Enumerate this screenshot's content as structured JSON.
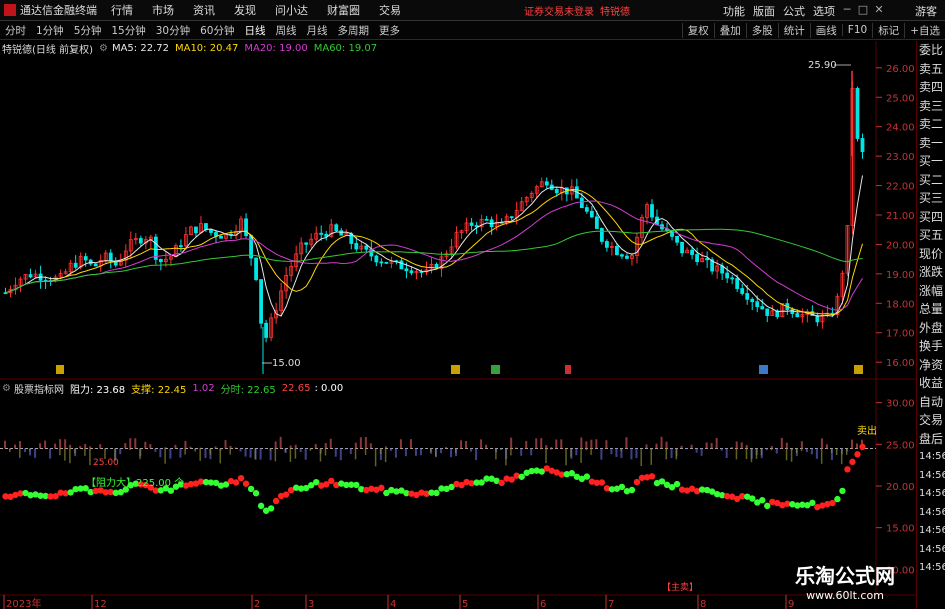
{
  "app": {
    "title": "通达信金融终端",
    "guest_label": "游客"
  },
  "menu": {
    "items": [
      "行情",
      "市场",
      "资讯",
      "发现",
      "问小达",
      "财富圈",
      "交易"
    ],
    "trade_notice": "证券交易未登录",
    "stock_notice": "特锐德"
  },
  "right_menu": [
    "功能",
    "版面",
    "公式",
    "选项"
  ],
  "toolbar": {
    "periods": [
      "分时",
      "1分钟",
      "5分钟",
      "15分钟",
      "30分钟",
      "60分钟",
      "日线",
      "周线",
      "月线",
      "多周期",
      "更多"
    ],
    "active": "日线",
    "right": [
      "复权",
      "叠加",
      "多股",
      "统计",
      "画线",
      "F10",
      "标记",
      "+自选"
    ]
  },
  "price_chart": {
    "stock_label": "特锐德(日线 前复权)",
    "ma": [
      {
        "label": "MA5: 22.72",
        "color": "#e8e8e8"
      },
      {
        "label": "MA10: 20.47",
        "color": "#ffd700"
      },
      {
        "label": "MA20: 19.00",
        "color": "#d23cd2"
      },
      {
        "label": "MA60: 19.07",
        "color": "#34c834"
      }
    ],
    "y_ticks": [
      "26.00",
      "25.00",
      "24.00",
      "23.00",
      "22.00",
      "21.00",
      "20.00",
      "19.00",
      "18.00",
      "17.00",
      "16.00"
    ],
    "y_range": [
      15.7,
      26.3
    ],
    "high_label": "25.90",
    "high_value": 25.9,
    "low_label": "15.00",
    "low_value": 15.0
  },
  "indicator": {
    "name": "股票指标网",
    "items": [
      {
        "label": "阻力: 23.68",
        "color": "#ffffff"
      },
      {
        "label": "支撑: 22.45",
        "color": "#ffd700"
      },
      {
        "label": "1.02",
        "color": "#d23cd2"
      },
      {
        "label": "分时: 22.65",
        "color": "#34c834"
      },
      {
        "label": "22.65",
        "color": "#ff4040"
      },
      {
        "label": ": 0.00",
        "color": "#ffffff"
      }
    ],
    "y_ticks": [
      "30.00",
      "25.00",
      "20.00",
      "15.00",
      "10.00"
    ],
    "y_range": [
      8,
      32
    ],
    "annotation_a": "【阻力大】225.00 个",
    "annotation_b": "【主卖】",
    "annotation_c": "25.00",
    "annotation_d": "卖出"
  },
  "x_axis": {
    "labels": [
      "2023年",
      "12",
      "2",
      "3",
      "4",
      "5",
      "6",
      "7",
      "8",
      "9"
    ]
  },
  "sidebar": {
    "items": [
      "委比",
      "卖五",
      "卖四",
      "卖三",
      "卖二",
      "卖一",
      "买一",
      "买二",
      "买三",
      "买四",
      "买五",
      "现价",
      "涨跌",
      "涨幅",
      "总量",
      "外盘",
      "换手",
      "净资",
      "收益",
      "自动",
      "交易",
      "盘后",
      "14:56",
      "14:56",
      "14:56",
      "14:56",
      "14:56",
      "14:56",
      "14:56"
    ]
  },
  "watermark": {
    "cn": "乐淘公式网",
    "url": "www.60lt.com"
  },
  "colors": {
    "up": "#ff3232",
    "down": "#00e5e5",
    "green": "#33ff33",
    "red": "#ff2020",
    "grid": "#5a0000"
  }
}
